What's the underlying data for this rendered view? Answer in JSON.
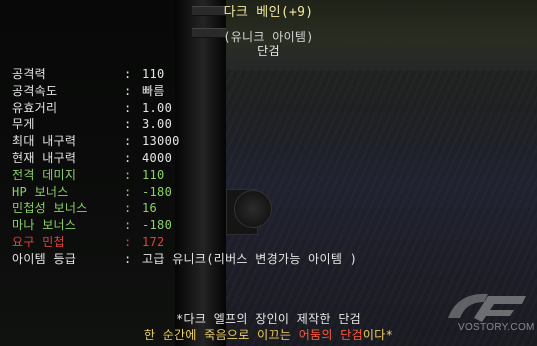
{
  "item": {
    "title": "다크 베인(+9)",
    "rarity": "(유니크 아이템)",
    "type": "단검"
  },
  "stats": [
    {
      "label": "공격력",
      "sep": ":",
      "value": "110",
      "color": "#e6e6e6"
    },
    {
      "label": "공격속도",
      "sep": ":",
      "value": "빠름",
      "color": "#e6e6e6"
    },
    {
      "label": "유효거리",
      "sep": ":",
      "value": "1.00",
      "color": "#e6e6e6"
    },
    {
      "label": "무게",
      "sep": ":",
      "value": "3.00",
      "color": "#e6e6e6"
    },
    {
      "label": "최대 내구력",
      "sep": ":",
      "value": "13000",
      "color": "#e6e6e6"
    },
    {
      "label": "현재 내구력",
      "sep": ":",
      "value": "4000",
      "color": "#e6e6e6"
    },
    {
      "label": "전격 데미지",
      "sep": ":",
      "value": "110",
      "color": "#8cd16a"
    },
    {
      "label": "HP 보너스",
      "sep": ":",
      "value": "-180",
      "color": "#8cd16a"
    },
    {
      "label": "민첩성 보너스",
      "sep": ":",
      "value": "16",
      "color": "#8cd16a"
    },
    {
      "label": "마나 보너스",
      "sep": ":",
      "value": "-180",
      "color": "#8cd16a"
    },
    {
      "label": "요구 민첩",
      "sep": ":",
      "value": "172",
      "color": "#e04040"
    },
    {
      "label": "아이템 등급",
      "sep": ":",
      "value": "고급 유니크(리버스 변경가능 아이템 )",
      "color": "#e6e6e6"
    }
  ],
  "footer": {
    "line1": "*다크 엘프의 장인이 제작한 단검",
    "line2_pre": "한 순간에 죽음으로 이끄는 ",
    "line2_hl": "어둠의 단검",
    "line2_post": "이다*"
  },
  "watermark": {
    "text": "VOSTORY.COM"
  }
}
